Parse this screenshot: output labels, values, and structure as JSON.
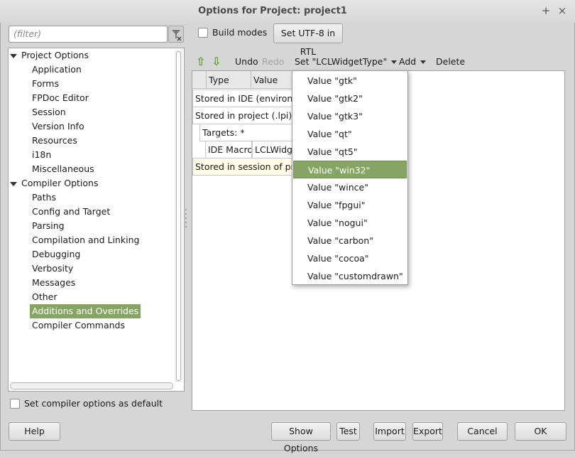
{
  "window": {
    "title": "Options for Project: project1",
    "buttons": [
      "+",
      "×"
    ]
  },
  "filter": {
    "placeholder": "(filter)"
  },
  "tree": {
    "items": [
      {
        "label": "Project Options",
        "level": 0,
        "expanded": true
      },
      {
        "label": "Application",
        "level": 1
      },
      {
        "label": "Forms",
        "level": 1
      },
      {
        "label": "FPDoc Editor",
        "level": 1
      },
      {
        "label": "Session",
        "level": 1
      },
      {
        "label": "Version Info",
        "level": 1
      },
      {
        "label": "Resources",
        "level": 1
      },
      {
        "label": "i18n",
        "level": 1
      },
      {
        "label": "Miscellaneous",
        "level": 1
      },
      {
        "label": "Compiler Options",
        "level": 0,
        "expanded": true
      },
      {
        "label": "Paths",
        "level": 1
      },
      {
        "label": "Config and Target",
        "level": 1
      },
      {
        "label": "Parsing",
        "level": 1
      },
      {
        "label": "Compilation and Linking",
        "level": 1
      },
      {
        "label": "Debugging",
        "level": 1
      },
      {
        "label": "Verbosity",
        "level": 1
      },
      {
        "label": "Messages",
        "level": 1
      },
      {
        "label": "Other",
        "level": 1
      },
      {
        "label": "Additions and Overrides",
        "level": 1,
        "selected": true
      },
      {
        "label": "Compiler Commands",
        "level": 1
      }
    ]
  },
  "top": {
    "build_modes_label": "Build modes",
    "set_utf8_label": "Set UTF-8 in RTL"
  },
  "toolbar": {
    "undo": "Undo",
    "redo": "Redo",
    "set_label": "Set \"LCLWidgetType\"",
    "add": "Add",
    "delete": "Delete"
  },
  "grid": {
    "headers": [
      "Type",
      "Value"
    ],
    "rows": {
      "ide": "Stored in IDE (environment",
      "project": "Stored in project (.lpi)",
      "targets": "Targets: *",
      "macro_type": "IDE Macro",
      "macro_value": "LCLWidgetType",
      "session": "Stored in session of project"
    }
  },
  "menu": {
    "items": [
      "Value \"gtk\"",
      "Value \"gtk2\"",
      "Value \"gtk3\"",
      "Value \"qt\"",
      "Value \"qt5\"",
      "Value \"win32\"",
      "Value \"wince\"",
      "Value \"fpgui\"",
      "Value \"nogui\"",
      "Value \"carbon\"",
      "Value \"cocoa\"",
      "Value \"customdrawn\""
    ],
    "active_index": 5
  },
  "bottom": {
    "set_default_label": "Set compiler options as default",
    "help": "Help",
    "show_options": "Show Options",
    "test": "Test",
    "import": "Import",
    "export": "Export",
    "cancel": "Cancel",
    "ok": "OK"
  },
  "colors": {
    "selection": "#86a565",
    "arrow": "#5aa02c"
  }
}
